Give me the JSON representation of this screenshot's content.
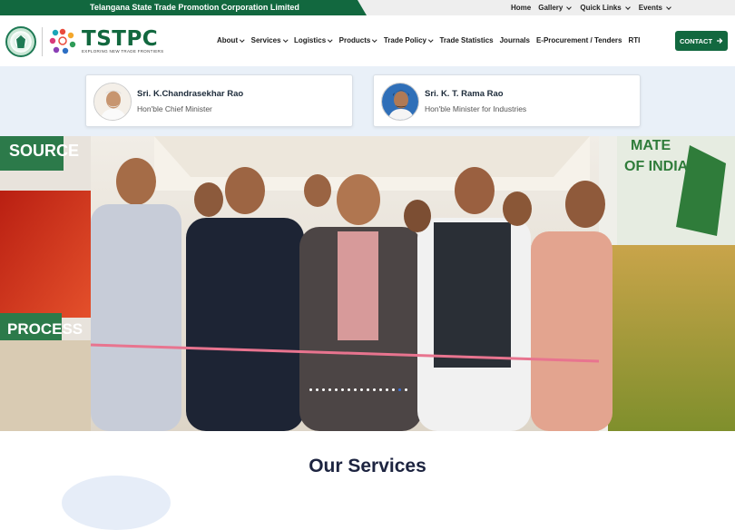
{
  "topbar": {
    "org_name": "Telangana State Trade Promotion Corporation Limited",
    "links": [
      {
        "label": "Home",
        "dropdown": false
      },
      {
        "label": "Gallery",
        "dropdown": true
      },
      {
        "label": "Quick Links",
        "dropdown": true
      },
      {
        "label": "Events",
        "dropdown": true
      }
    ]
  },
  "header": {
    "logo_text": "TSTPC",
    "logo_tagline": "EXPLORING NEW TRADE FRONTIERS",
    "nav": [
      {
        "label": "About",
        "dropdown": true
      },
      {
        "label": "Services",
        "dropdown": true
      },
      {
        "label": "Logistics",
        "dropdown": true
      },
      {
        "label": "Products",
        "dropdown": true
      },
      {
        "label": "Trade Policy",
        "dropdown": true
      },
      {
        "label": "Trade Statistics",
        "dropdown": false
      },
      {
        "label": "Journals",
        "dropdown": false
      },
      {
        "label": "E-Procurement / Tenders",
        "dropdown": false
      },
      {
        "label": "RTI",
        "dropdown": false
      }
    ],
    "contact_label": "CONTACT"
  },
  "leaders": [
    {
      "name": "Sri. K.Chandrasekhar Rao",
      "role": "Hon'ble Chief Minister"
    },
    {
      "name": "Sri. K. T. Rama Rao",
      "role": "Hon'ble Minister for Industries"
    }
  ],
  "banner": {
    "signs": {
      "left_top": "SOURCE",
      "left_bottom": "PROCESS",
      "right_top_1": "MATE",
      "right_top_2": "OF INDIA!"
    },
    "slide_count": 16,
    "active_slide": 14
  },
  "services": {
    "title": "Our Services"
  },
  "colors": {
    "brand_green": "#12683f",
    "topbar_grey": "#eeeeee",
    "band_blue": "#e9f0f8",
    "dot_active": "#3b6fd6"
  }
}
